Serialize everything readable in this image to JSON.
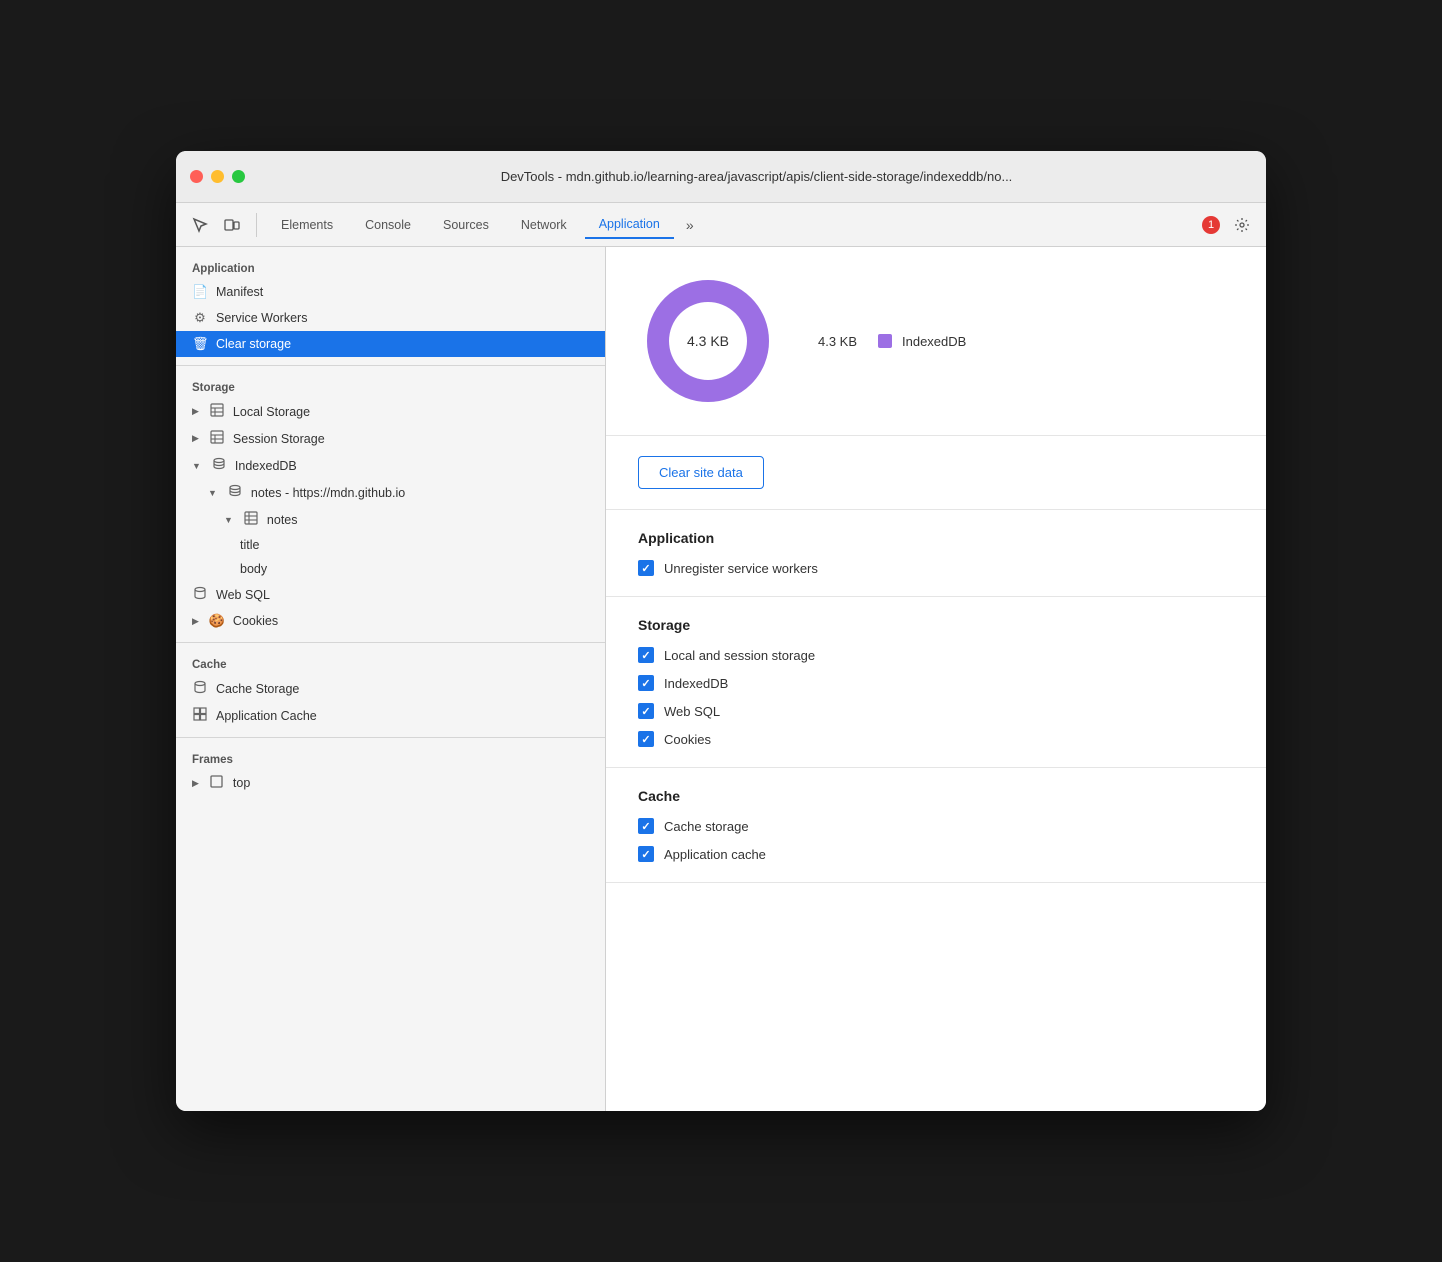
{
  "titlebar": {
    "title": "DevTools - mdn.github.io/learning-area/javascript/apis/client-side-storage/indexeddb/no..."
  },
  "toolbar": {
    "tabs": [
      "Elements",
      "Console",
      "Sources",
      "Network",
      "Application"
    ],
    "active_tab": "Application",
    "error_count": "1"
  },
  "sidebar": {
    "sections": [
      {
        "label": "Application",
        "items": [
          {
            "id": "manifest",
            "label": "Manifest",
            "icon": "📄",
            "indent": 0
          },
          {
            "id": "service-workers",
            "label": "Service Workers",
            "icon": "⚙",
            "indent": 0
          },
          {
            "id": "clear-storage",
            "label": "Clear storage",
            "icon": "🗑",
            "indent": 0,
            "active": true
          }
        ]
      },
      {
        "label": "Storage",
        "items": [
          {
            "id": "local-storage",
            "label": "Local Storage",
            "icon": "▶",
            "indent": 0,
            "hasArrow": true
          },
          {
            "id": "session-storage",
            "label": "Session Storage",
            "icon": "▶",
            "indent": 0,
            "hasArrow": true
          },
          {
            "id": "indexeddb",
            "label": "IndexedDB",
            "icon": "▼",
            "indent": 0,
            "hasArrow": true,
            "expanded": true
          },
          {
            "id": "notes-db",
            "label": "notes - https://mdn.github.io",
            "icon": "▼",
            "indent": 1,
            "hasArrow": true,
            "expanded": true
          },
          {
            "id": "notes-table",
            "label": "notes",
            "icon": "▼",
            "indent": 2,
            "hasArrow": true,
            "expanded": true
          },
          {
            "id": "title-field",
            "label": "title",
            "indent": 3
          },
          {
            "id": "body-field",
            "label": "body",
            "indent": 3
          },
          {
            "id": "websql",
            "label": "Web SQL",
            "icon": "💾",
            "indent": 0
          },
          {
            "id": "cookies",
            "label": "Cookies",
            "icon": "🍪",
            "indent": 0,
            "hasArrow": true
          }
        ]
      },
      {
        "label": "Cache",
        "items": [
          {
            "id": "cache-storage",
            "label": "Cache Storage",
            "icon": "💾",
            "indent": 0
          },
          {
            "id": "app-cache",
            "label": "Application Cache",
            "icon": "🔲",
            "indent": 0
          }
        ]
      },
      {
        "label": "Frames",
        "items": [
          {
            "id": "top-frame",
            "label": "top",
            "icon": "▶",
            "indent": 0,
            "hasFrame": true
          }
        ]
      }
    ]
  },
  "content": {
    "chart": {
      "center_label": "4.3 KB",
      "legend_size": "4.3 KB",
      "legend_label": "IndexedDB",
      "legend_color": "#9c6fe4"
    },
    "clear_button_label": "Clear site data",
    "application_section": {
      "title": "Application",
      "items": [
        {
          "label": "Unregister service workers",
          "checked": true
        }
      ]
    },
    "storage_section": {
      "title": "Storage",
      "items": [
        {
          "label": "Local and session storage",
          "checked": true
        },
        {
          "label": "IndexedDB",
          "checked": true
        },
        {
          "label": "Web SQL",
          "checked": true
        },
        {
          "label": "Cookies",
          "checked": true
        }
      ]
    },
    "cache_section": {
      "title": "Cache",
      "items": [
        {
          "label": "Cache storage",
          "checked": true
        },
        {
          "label": "Application cache",
          "checked": true
        }
      ]
    }
  }
}
